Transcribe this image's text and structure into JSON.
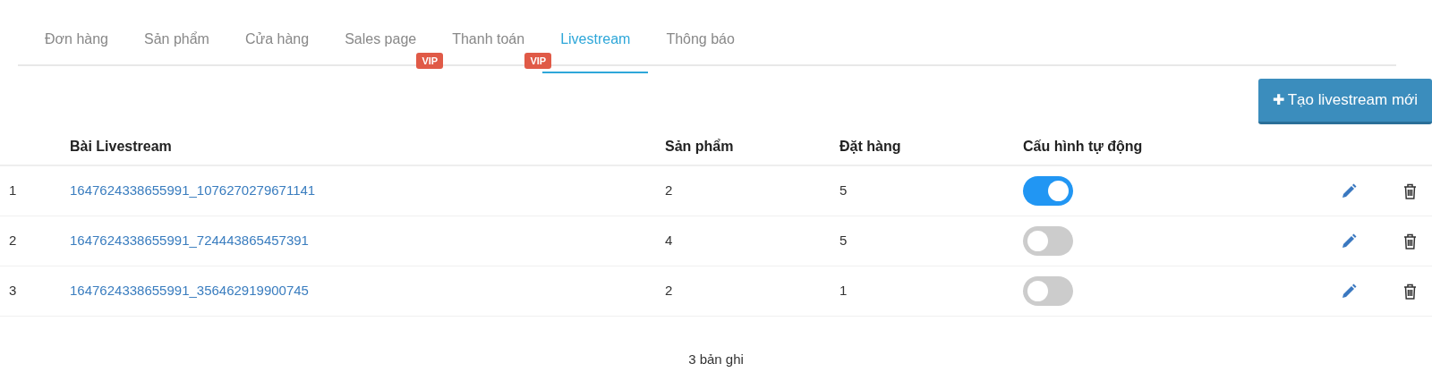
{
  "tabs": [
    {
      "label": "Đơn hàng",
      "selected": false
    },
    {
      "label": "Sản phẩm",
      "selected": false
    },
    {
      "label": "Cửa hàng",
      "selected": false
    },
    {
      "label": "Sales page",
      "selected": false,
      "badge": "VIP"
    },
    {
      "label": "Thanh toán",
      "selected": false,
      "badge": "VIP"
    },
    {
      "label": "Livestream",
      "selected": true
    },
    {
      "label": "Thông báo",
      "selected": false
    }
  ],
  "create_button": {
    "icon": "✚",
    "label": "Tạo livestream mới"
  },
  "table": {
    "columns": [
      "Bài Livestream",
      "Sản phẩm",
      "Đặt hàng",
      "Cấu hình tự động"
    ],
    "rows": [
      {
        "index": "1",
        "post": "1647624338655991_1076270279671141",
        "products": "2",
        "orders": "5",
        "auto_config": true
      },
      {
        "index": "2",
        "post": "1647624338655991_724443865457391",
        "products": "4",
        "orders": "5",
        "auto_config": false
      },
      {
        "index": "3",
        "post": "1647624338655991_356462919900745",
        "products": "2",
        "orders": "1",
        "auto_config": false
      }
    ]
  },
  "footer": "3 bản ghi"
}
